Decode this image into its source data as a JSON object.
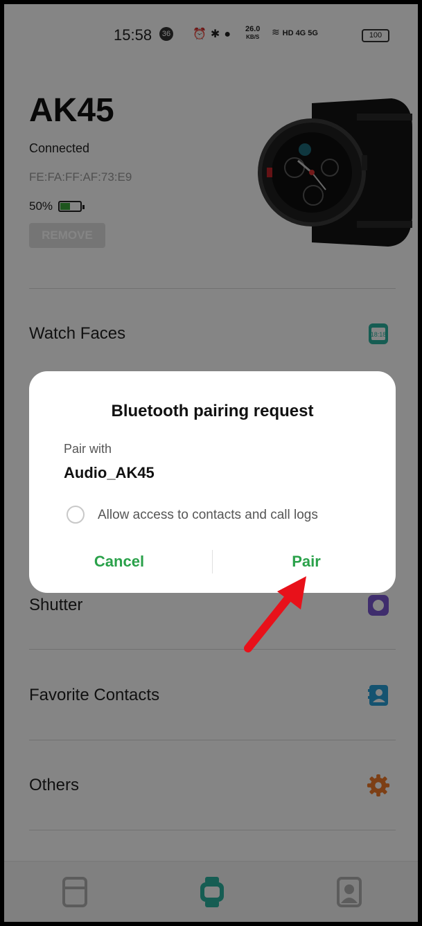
{
  "status_bar": {
    "time": "15:58",
    "notification_count": "36",
    "net_speed_value": "26.0",
    "net_speed_unit": "KB/S",
    "network_labels": "HD 4G 5G",
    "battery": "100"
  },
  "device": {
    "name": "AK45",
    "status": "Connected",
    "mac": "FE:FA:FF:AF:73:E9",
    "battery_level": "50%",
    "battery_fraction": 0.5,
    "remove_label": "REMOVE"
  },
  "menu": {
    "items": [
      {
        "label": "Watch Faces",
        "icon": "watch-face-icon",
        "color": "#2bb3a0"
      },
      {
        "label": "Shutter",
        "icon": "shutter-icon",
        "color": "#7a57d1"
      },
      {
        "label": "Favorite Contacts",
        "icon": "contacts-icon",
        "color": "#2a9fd6"
      },
      {
        "label": "Others",
        "icon": "gear-icon",
        "color": "#f07a2a"
      }
    ]
  },
  "bottom_nav": {
    "items": [
      {
        "icon": "home-icon",
        "active": false
      },
      {
        "icon": "watch-icon",
        "active": true
      },
      {
        "icon": "profile-icon",
        "active": false
      }
    ],
    "active_color": "#2bb3a0"
  },
  "dialog": {
    "title": "Bluetooth pairing request",
    "pair_with_label": "Pair with",
    "device_name": "Audio_AK45",
    "checkbox_label": "Allow access to contacts and call logs",
    "cancel_label": "Cancel",
    "pair_label": "Pair",
    "accent_color": "#2aa14a"
  },
  "annotation": {
    "arrow_color": "#e8111a"
  }
}
